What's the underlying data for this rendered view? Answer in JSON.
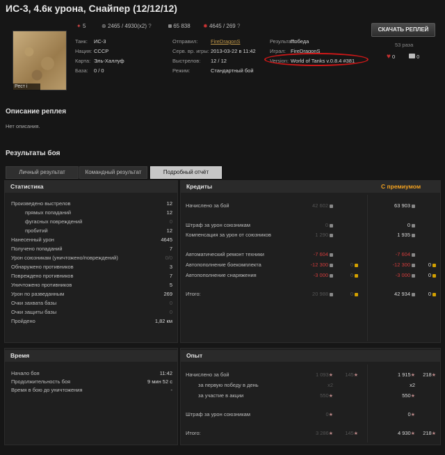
{
  "title": "ИС-3, 4.6к урона, Снайпер (12/12/12)",
  "header_stats": {
    "frags": "5",
    "damage": "2465 / 4930(x2)",
    "credits": "65 838",
    "xp": "4645 / 269"
  },
  "map": {
    "label": "Рест i"
  },
  "info_left": [
    {
      "label": "Танк:",
      "value": "ИС-3"
    },
    {
      "label": "Нация:",
      "value": "СССР"
    },
    {
      "label": "Карта:",
      "value": "Эль-Халлуф"
    },
    {
      "label": "База:",
      "value": "0 / 0"
    }
  ],
  "info_mid": [
    {
      "label": "Отправил:",
      "value": "FireDragonS",
      "link": true
    },
    {
      "label": "Серв. вр. игры:",
      "value": "2013-03-22 в 11:42"
    },
    {
      "label": "Выстрелов:",
      "value": "12 / 12"
    },
    {
      "label": "Режим:",
      "value": "Стандартный бой"
    }
  ],
  "info_right": [
    {
      "label": "Результат:",
      "value": "Победа"
    },
    {
      "label": "Играл:",
      "value": "FireDragonS"
    },
    {
      "label": "Version:",
      "value": "World of Tanks v.0.8.4 #381"
    }
  ],
  "download": {
    "label": "СКАЧАТЬ РЕПЛЕЙ",
    "count": "53 раза",
    "likes": "0",
    "comments": "0"
  },
  "description": {
    "heading": "Описание реплея",
    "text": "Нет описания."
  },
  "results_heading": "Результаты боя",
  "tabs": [
    "Личный результат",
    "Командный результат",
    "Подробный отчёт"
  ],
  "stats": {
    "heading": "Статистика",
    "rows": [
      {
        "n": "Произведено выстрелов",
        "v": "12",
        "indent": 0
      },
      {
        "n": "прямых попаданий",
        "v": "12",
        "indent": 1
      },
      {
        "n": "фугасных повреждений",
        "v": "0",
        "indent": 1,
        "dim": true
      },
      {
        "n": "пробитий",
        "v": "12",
        "indent": 1
      },
      {
        "n": "Нанесенный урон",
        "v": "4645",
        "indent": 0
      },
      {
        "n": "Получено попаданий",
        "v": "7",
        "indent": 0
      },
      {
        "n": "Урон союзникам (уничтожено/повреждений)",
        "v": "0/0",
        "indent": 0,
        "dim": true
      },
      {
        "n": "Обнаружено противников",
        "v": "3",
        "indent": 0
      },
      {
        "n": "Повреждено противников",
        "v": "7",
        "indent": 0
      },
      {
        "n": "Уничтожено противников",
        "v": "5",
        "indent": 0
      },
      {
        "n": "Урон по разведанным",
        "v": "269",
        "indent": 0
      },
      {
        "n": "Очки захвата базы",
        "v": "0",
        "indent": 0,
        "dim": true
      },
      {
        "n": "Очки защиты базы",
        "v": "0",
        "indent": 0,
        "dim": true
      },
      {
        "n": "Пройдено",
        "v": "1,82 км",
        "indent": 0
      }
    ]
  },
  "credits": {
    "heading": "Кредиты",
    "premium_heading": "С премиумом",
    "rows": [
      {
        "n": "Начислено за бой",
        "a": "42 602",
        "b": "63 903"
      },
      {
        "n": "Штраф за урон союзникам",
        "a": "0",
        "b": "0"
      },
      {
        "n": "Компенсация за урон от союзников",
        "a": "1 290",
        "b": "1 935"
      },
      {
        "n": "Автоматический ремонт техники",
        "a": "-7 604",
        "b": "-7 604"
      },
      {
        "n": "Автопополнение боекомплекта",
        "a": "-12 300",
        "ag": "0",
        "b": "-12 300",
        "bg": "0"
      },
      {
        "n": "Автопополнение снаряжения",
        "a": "-3 000",
        "ag": "0",
        "b": "-3 000",
        "bg": "0"
      },
      {
        "n": "Итого:",
        "a": "20 988",
        "ag": "0",
        "b": "42 934",
        "bg": "0"
      }
    ]
  },
  "time": {
    "heading": "Время",
    "rows": [
      {
        "n": "Начало боя",
        "v": "11:42"
      },
      {
        "n": "Продолжительность боя",
        "v": "9 мин 52 с"
      },
      {
        "n": "Время в бою до уничтожения",
        "v": "-"
      }
    ]
  },
  "xp": {
    "heading": "Опыт",
    "rows": [
      {
        "n": "Начислено за бой",
        "a": "1 093",
        "af": "145",
        "b": "1 915",
        "bf": "218"
      },
      {
        "n": "за первую победу в день",
        "a": "x2",
        "b": "x2"
      },
      {
        "n": "за участие в акции",
        "a": "550",
        "b": "550"
      },
      {
        "n": "Штраф за урон союзникам",
        "a": "0",
        "b": "0"
      },
      {
        "n": "Итого:",
        "a": "3 286",
        "af": "145",
        "b": "4 930",
        "bf": "218"
      }
    ]
  }
}
